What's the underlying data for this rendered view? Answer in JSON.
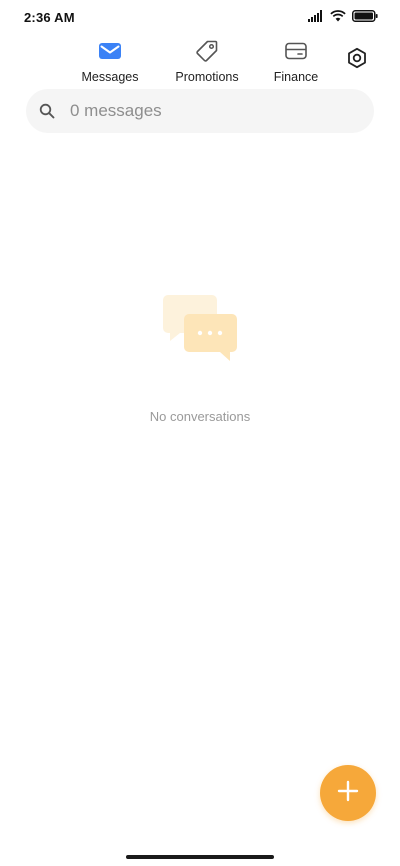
{
  "status_bar": {
    "time": "2:36 AM",
    "icons": [
      "signal-icon",
      "wifi-icon",
      "battery-icon"
    ]
  },
  "tabs": [
    {
      "label": "Messages",
      "icon": "mail-icon",
      "active": true
    },
    {
      "label": "Promotions",
      "icon": "tag-icon",
      "active": false
    },
    {
      "label": "Finance",
      "icon": "card-icon",
      "active": false
    }
  ],
  "settings": {
    "icon": "settings-icon"
  },
  "search": {
    "placeholder": "0 messages",
    "value": ""
  },
  "empty_state": {
    "icon": "chat-bubbles-icon",
    "text": "No conversations"
  },
  "fab": {
    "icon": "plus-icon"
  },
  "colors": {
    "accent": "#f6a83a",
    "active_tab_icon": "#3b82f6",
    "search_bg": "#f5f5f5",
    "empty_text": "#9a9a9a"
  }
}
